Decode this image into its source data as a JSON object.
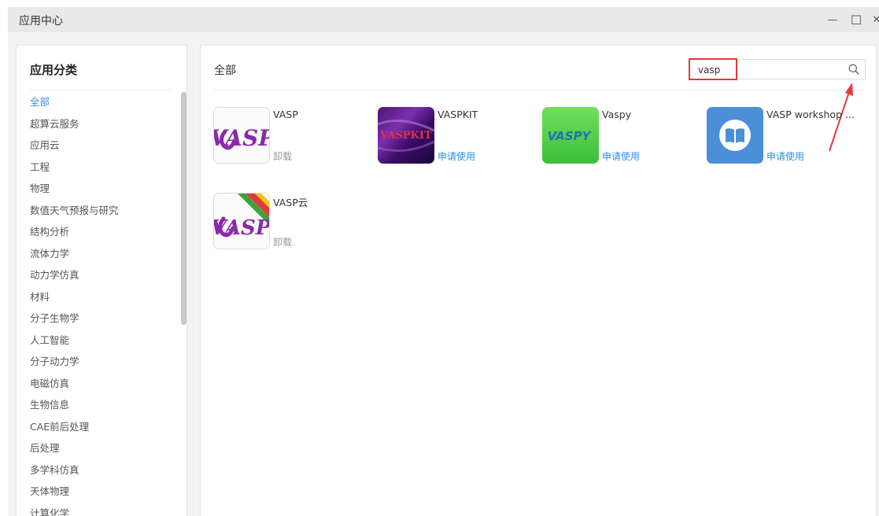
{
  "window": {
    "title": "应用中心",
    "minimize_glyph": "—",
    "maximize_glyph": "☐",
    "close_glyph": "✕"
  },
  "sidebar": {
    "title": "应用分类",
    "items": [
      {
        "label": "全部",
        "active": true
      },
      {
        "label": "超算云服务"
      },
      {
        "label": "应用云"
      },
      {
        "label": "工程"
      },
      {
        "label": "物理"
      },
      {
        "label": "数值天气预报与研究"
      },
      {
        "label": "结构分析"
      },
      {
        "label": "流体力学"
      },
      {
        "label": "动力学仿真"
      },
      {
        "label": "材料"
      },
      {
        "label": "分子生物学"
      },
      {
        "label": "人工智能"
      },
      {
        "label": "分子动力学"
      },
      {
        "label": "电磁仿真"
      },
      {
        "label": "生物信息"
      },
      {
        "label": "CAE前后处理"
      },
      {
        "label": "后处理"
      },
      {
        "label": "多学科仿真"
      },
      {
        "label": "天体物理"
      },
      {
        "label": "计算化学"
      }
    ]
  },
  "main": {
    "title": "全部",
    "search": {
      "value": "vasp",
      "icon": "search-icon"
    },
    "apps": [
      {
        "name": "VASP",
        "action": "卸载",
        "action_type": "uninstall",
        "icon_text": "VASP",
        "icon": "vasp-logo-icon"
      },
      {
        "name": "VASPKIT",
        "action": "申请使用",
        "action_type": "apply",
        "icon_text": "VASPKIT",
        "icon": "vaspkit-logo-icon"
      },
      {
        "name": "Vaspy",
        "action": "申请使用",
        "action_type": "apply",
        "icon_text": "VASPY",
        "icon": "vaspy-logo-icon"
      },
      {
        "name": "VASP workshop ...",
        "action": "申请使用",
        "action_type": "apply",
        "icon": "book-icon"
      },
      {
        "name": "VASP云",
        "action": "卸载",
        "action_type": "uninstall",
        "icon_text": "VASP",
        "icon": "vasp-cloud-logo-icon"
      }
    ]
  },
  "colors": {
    "accent": "#3a8ee6",
    "apply_link": "#2f8ee8",
    "muted": "#999999",
    "highlight_red": "#e23b3b"
  }
}
